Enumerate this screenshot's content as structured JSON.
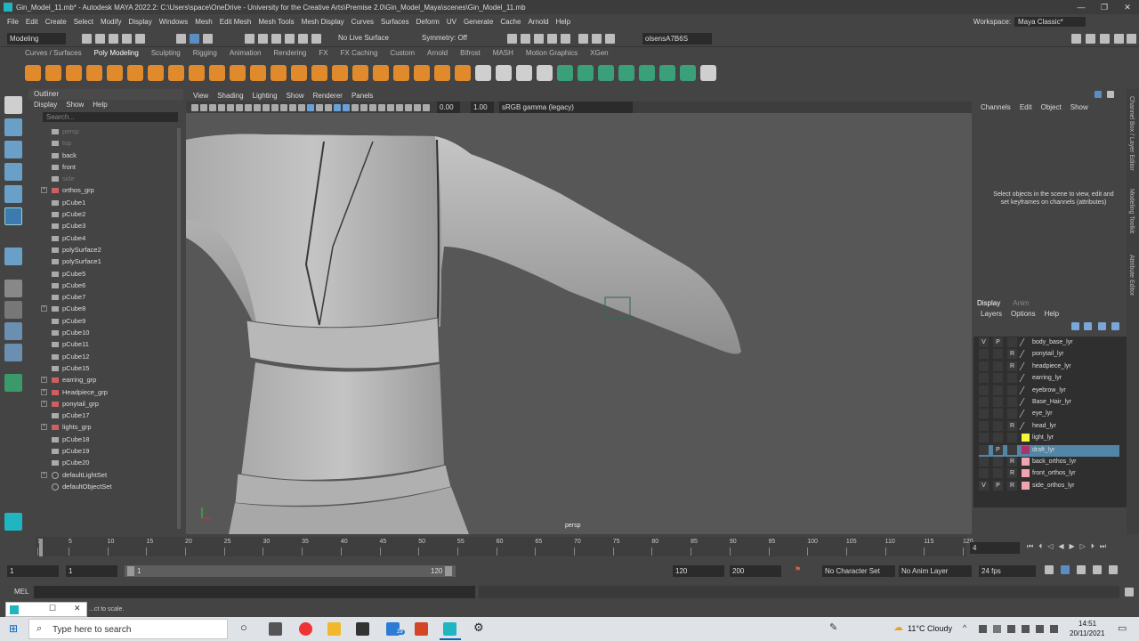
{
  "window": {
    "title": "Gin_Model_11.mb* - Autodesk MAYA 2022.2: C:\\Users\\space\\OneDrive - University for the Creative Arts\\Premise 2.0\\Gin_Model_Maya\\scenes\\Gin_Model_11.mb",
    "controls": [
      "—",
      "❐",
      "✕"
    ]
  },
  "menubar": {
    "items": [
      "File",
      "Edit",
      "Create",
      "Select",
      "Modify",
      "Display",
      "Windows",
      "Mesh",
      "Edit Mesh",
      "Mesh Tools",
      "Mesh Display",
      "Curves",
      "Surfaces",
      "Deform",
      "UV",
      "Generate",
      "Cache",
      "Arnold",
      "Help"
    ],
    "workspace_label": "Workspace:",
    "workspace_value": "Maya Classic*"
  },
  "statusline": {
    "mode": "Modeling",
    "live_surface": "No Live Surface",
    "symmetry": "Symmetry: Off",
    "user": "olsensA7B6S"
  },
  "shelf": {
    "tabs": [
      "Curves / Surfaces",
      "Poly Modeling",
      "Sculpting",
      "Rigging",
      "Animation",
      "Rendering",
      "FX",
      "FX Caching",
      "Custom",
      "Arnold",
      "Bifrost",
      "MASH",
      "Motion Graphics",
      "XGen"
    ],
    "active_tab": "Poly Modeling"
  },
  "outliner": {
    "title": "Outliner",
    "menu": [
      "Display",
      "Show",
      "Help"
    ],
    "search_placeholder": "Search...",
    "rows": [
      {
        "label": "persp",
        "dim": true,
        "kind": "cam"
      },
      {
        "label": "top",
        "dim": true,
        "kind": "cam"
      },
      {
        "label": "back",
        "dim": false,
        "kind": "cam"
      },
      {
        "label": "front",
        "dim": false,
        "kind": "cam"
      },
      {
        "label": "side",
        "dim": true,
        "kind": "cam"
      },
      {
        "label": "orthos_grp",
        "dim": false,
        "kind": "grp",
        "expand": true
      },
      {
        "label": "pCube1",
        "kind": "mesh"
      },
      {
        "label": "pCube2",
        "kind": "mesh"
      },
      {
        "label": "pCube3",
        "kind": "mesh"
      },
      {
        "label": "pCube4",
        "kind": "mesh"
      },
      {
        "label": "polySurface2",
        "kind": "mesh"
      },
      {
        "label": "polySurface1",
        "kind": "mesh"
      },
      {
        "label": "pCube5",
        "kind": "mesh"
      },
      {
        "label": "pCube6",
        "kind": "mesh"
      },
      {
        "label": "pCube7",
        "kind": "mesh"
      },
      {
        "label": "pCube8",
        "kind": "mesh",
        "expand": true
      },
      {
        "label": "pCube9",
        "kind": "mesh"
      },
      {
        "label": "pCube10",
        "kind": "mesh"
      },
      {
        "label": "pCube11",
        "kind": "mesh"
      },
      {
        "label": "pCube12",
        "kind": "mesh"
      },
      {
        "label": "pCube15",
        "kind": "mesh"
      },
      {
        "label": "earring_grp",
        "kind": "grp",
        "expand": true
      },
      {
        "label": "Headpiece_grp",
        "kind": "grp",
        "expand": true
      },
      {
        "label": "ponytail_grp",
        "kind": "grp",
        "expand": true
      },
      {
        "label": "pCube17",
        "kind": "mesh"
      },
      {
        "label": "lights_grp",
        "kind": "grp",
        "expand": true
      },
      {
        "label": "pCube18",
        "kind": "mesh"
      },
      {
        "label": "pCube19",
        "kind": "mesh"
      },
      {
        "label": "pCube20",
        "kind": "mesh"
      },
      {
        "label": "defaultLightSet",
        "kind": "set",
        "expand": true
      },
      {
        "label": "defaultObjectSet",
        "kind": "set"
      }
    ]
  },
  "viewport": {
    "menu": [
      "View",
      "Shading",
      "Lighting",
      "Show",
      "Renderer",
      "Panels"
    ],
    "exposure": "0.00",
    "gamma": "1.00",
    "colorspace": "sRGB gamma (legacy)",
    "camera_label": "persp"
  },
  "channelbox": {
    "menu": [
      "Channels",
      "Edit",
      "Object",
      "Show"
    ],
    "hint": "Select objects in the scene to view, edit and set keyframes on channels (attributes)"
  },
  "layers": {
    "tabs": [
      "Display",
      "Anim"
    ],
    "menu": [
      "Layers",
      "Options",
      "Help"
    ],
    "items": [
      {
        "name": "body_base_lyr",
        "v": "V",
        "p": "P",
        "r": "",
        "color": "none",
        "selected": false
      },
      {
        "name": "ponytail_lyr",
        "v": "",
        "p": "",
        "r": "R",
        "color": "none",
        "selected": false
      },
      {
        "name": "headpiece_lyr",
        "v": "",
        "p": "",
        "r": "R",
        "color": "none",
        "selected": false
      },
      {
        "name": "earring_lyr",
        "v": "",
        "p": "",
        "r": "",
        "color": "none",
        "selected": false
      },
      {
        "name": "eyebrow_lyr",
        "v": "",
        "p": "",
        "r": "",
        "color": "none",
        "selected": false
      },
      {
        "name": "Base_Hair_lyr",
        "v": "",
        "p": "",
        "r": "",
        "color": "none",
        "selected": false
      },
      {
        "name": "eye_lyr",
        "v": "",
        "p": "",
        "r": "",
        "color": "none",
        "selected": false
      },
      {
        "name": "head_lyr",
        "v": "",
        "p": "",
        "r": "R",
        "color": "none",
        "selected": false
      },
      {
        "name": "light_lyr",
        "v": "",
        "p": "",
        "r": "",
        "color": "#f5f53a",
        "selected": false
      },
      {
        "name": "draft_lyr",
        "v": "",
        "p": "P",
        "r": "",
        "color": "#b0306a",
        "selected": true
      },
      {
        "name": "back_orthos_lyr",
        "v": "",
        "p": "",
        "r": "R",
        "color": "#f2a3b0",
        "selected": false
      },
      {
        "name": "front_orthos_lyr",
        "v": "",
        "p": "",
        "r": "R",
        "color": "#f2a3b0",
        "selected": false
      },
      {
        "name": "side_orthos_lyr",
        "v": "V",
        "p": "P",
        "r": "R",
        "color": "#f2a3b0",
        "selected": false
      }
    ]
  },
  "side_tabs": [
    "Channel Box / Layer Editor",
    "Modeling Toolkit",
    "Attribute Editor"
  ],
  "timeline": {
    "ticks": [
      "1",
      "5",
      "10",
      "15",
      "20",
      "25",
      "30",
      "35",
      "40",
      "45",
      "50",
      "55",
      "60",
      "65",
      "70",
      "75",
      "80",
      "85",
      "90",
      "95",
      "100",
      "105",
      "110",
      "115",
      "120"
    ],
    "current_frame": "4",
    "range_start": "1",
    "range_start2": "1",
    "slider_start": "1",
    "slider_end": "120",
    "end": "120",
    "end2": "200",
    "character_set": "No Character Set",
    "anim_layer": "No Anim Layer",
    "fps": "24 fps"
  },
  "cmdline": {
    "label": "MEL",
    "help": "...ct to scale."
  },
  "taskbar": {
    "search_placeholder": "Type here to search",
    "weather": "11°C  Cloudy",
    "time": "14:51",
    "date": "20/11/2021",
    "badge": "29"
  }
}
